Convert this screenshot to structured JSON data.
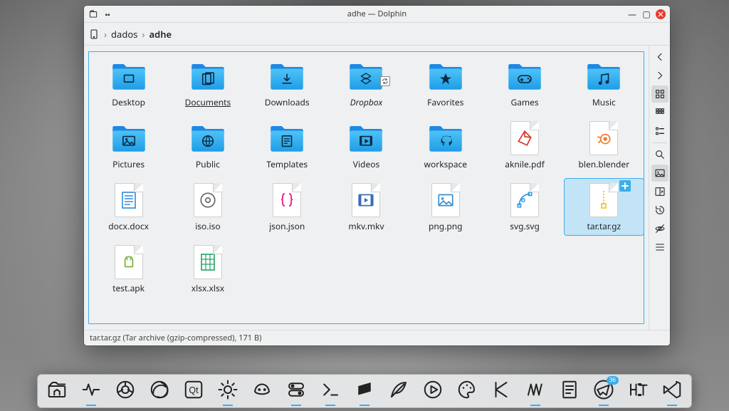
{
  "window": {
    "title": "adhe — Dolphin",
    "breadcrumb": {
      "parent": "dados",
      "current": "adhe"
    }
  },
  "items": [
    {
      "name": "Desktop",
      "kind": "folder",
      "glyph": "desktop"
    },
    {
      "name": "Documents",
      "kind": "folder",
      "glyph": "documents",
      "underline": true
    },
    {
      "name": "Downloads",
      "kind": "folder",
      "glyph": "downloads"
    },
    {
      "name": "Dropbox",
      "kind": "folder",
      "glyph": "dropbox",
      "italic": true,
      "sync": true
    },
    {
      "name": "Favorites",
      "kind": "folder",
      "glyph": "favorites"
    },
    {
      "name": "Games",
      "kind": "folder",
      "glyph": "games"
    },
    {
      "name": "Music",
      "kind": "folder",
      "glyph": "music"
    },
    {
      "name": "Pictures",
      "kind": "folder",
      "glyph": "pictures"
    },
    {
      "name": "Public",
      "kind": "folder",
      "glyph": "public"
    },
    {
      "name": "Templates",
      "kind": "folder",
      "glyph": "templates"
    },
    {
      "name": "Videos",
      "kind": "folder",
      "glyph": "videos"
    },
    {
      "name": "workspace",
      "kind": "folder",
      "glyph": "github"
    },
    {
      "name": "aknile.pdf",
      "kind": "file",
      "glyph": "pdf",
      "color": "#da3b2f"
    },
    {
      "name": "blen.blender",
      "kind": "file",
      "glyph": "blender",
      "color": "#f5792a"
    },
    {
      "name": "docx.docx",
      "kind": "file",
      "glyph": "doc",
      "color": "#2e8ad8"
    },
    {
      "name": "iso.iso",
      "kind": "file",
      "glyph": "iso",
      "color": "#6a6a6a"
    },
    {
      "name": "json.json",
      "kind": "file",
      "glyph": "json",
      "color": "#e6177d"
    },
    {
      "name": "mkv.mkv",
      "kind": "file",
      "glyph": "video",
      "color": "#3a6fb7"
    },
    {
      "name": "png.png",
      "kind": "file",
      "glyph": "image",
      "color": "#3a8fcf"
    },
    {
      "name": "svg.svg",
      "kind": "file",
      "glyph": "vector",
      "color": "#2f98e0"
    },
    {
      "name": "tar.tar.gz",
      "kind": "file",
      "glyph": "archive",
      "color": "#f0c419",
      "selected": true,
      "emblem": "add"
    },
    {
      "name": "test.apk",
      "kind": "file",
      "glyph": "android",
      "color": "#7cb342"
    },
    {
      "name": "xlsx.xlsx",
      "kind": "file",
      "glyph": "sheet",
      "color": "#1fa463"
    }
  ],
  "statusbar": "tar.tar.gz (Tar archive (gzip-compressed), 171 B)",
  "side_buttons": [
    {
      "name": "nav-back",
      "glyph": "chev-left"
    },
    {
      "name": "nav-forward",
      "glyph": "chev-right"
    },
    {
      "name": "view-icons",
      "glyph": "grid-large",
      "active": true
    },
    {
      "name": "view-compact",
      "glyph": "grid-small"
    },
    {
      "name": "view-details",
      "glyph": "list"
    },
    {
      "name": "sep"
    },
    {
      "name": "find",
      "glyph": "search"
    },
    {
      "name": "preview",
      "glyph": "preview",
      "active": true
    },
    {
      "name": "split",
      "glyph": "split"
    },
    {
      "name": "history",
      "glyph": "history"
    },
    {
      "name": "hidden",
      "glyph": "eye-off"
    },
    {
      "name": "menu",
      "glyph": "hamburger"
    }
  ],
  "dock": [
    {
      "name": "files",
      "glyph": "home-folder"
    },
    {
      "name": "monitor",
      "glyph": "pulse",
      "running": true
    },
    {
      "name": "chrome",
      "glyph": "chrome"
    },
    {
      "name": "firefox",
      "glyph": "firefox"
    },
    {
      "name": "qt",
      "glyph": "qt"
    },
    {
      "name": "settings",
      "glyph": "gear-sun",
      "running": true
    },
    {
      "name": "gimp",
      "glyph": "gimp"
    },
    {
      "name": "tweaks",
      "glyph": "toggles",
      "running": true
    },
    {
      "name": "terminal",
      "glyph": "terminal",
      "running": true
    },
    {
      "name": "sublime",
      "glyph": "sublime",
      "running": true
    },
    {
      "name": "writer",
      "glyph": "feather"
    },
    {
      "name": "media",
      "glyph": "play-circle"
    },
    {
      "name": "paint",
      "glyph": "palette"
    },
    {
      "name": "K",
      "glyph": "K"
    },
    {
      "name": "audio",
      "glyph": "wave",
      "running": true
    },
    {
      "name": "notes",
      "glyph": "note"
    },
    {
      "name": "telegram",
      "glyph": "telegram",
      "badge": "36",
      "running": true
    },
    {
      "name": "typography",
      "glyph": "hT"
    },
    {
      "name": "vscode",
      "glyph": "vscode",
      "running": true
    }
  ]
}
